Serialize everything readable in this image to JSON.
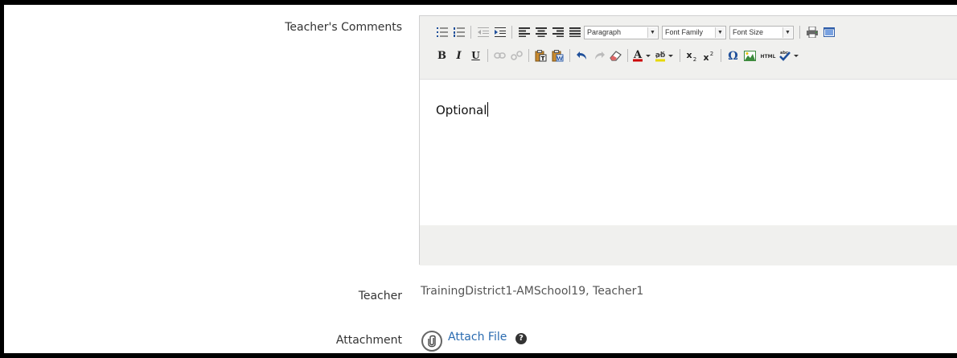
{
  "labels": {
    "comments": "Teacher's Comments",
    "teacher": "Teacher",
    "attachment": "Attachment"
  },
  "editor": {
    "toolbar": {
      "paragraph_select": "Paragraph",
      "font_family_select": "Font Family",
      "font_size_select": "Font Size",
      "html_button": "HTML"
    },
    "content": "Optional"
  },
  "teacher_value": "TrainingDistrict1-AMSchool19, Teacher1",
  "attachment": {
    "link_label": "Attach File",
    "help_glyph": "?"
  },
  "icons": {
    "bullet_list": "bullet-list-icon",
    "numbered_list": "numbered-list-icon",
    "outdent": "outdent-icon",
    "indent": "indent-icon",
    "align_left": "align-left-icon",
    "align_center": "align-center-icon",
    "align_right": "align-right-icon",
    "justify": "justify-icon",
    "print": "print-icon",
    "fullscreen": "fullscreen-icon",
    "link": "link-icon",
    "unlink": "unlink-icon",
    "paste_text": "paste-text-icon",
    "paste_word": "paste-word-icon",
    "undo": "undo-icon",
    "redo": "redo-icon",
    "remove_format": "eraser-icon",
    "font_color": "font-color-icon",
    "highlight": "highlight-icon",
    "subscript": "subscript-icon",
    "superscript": "superscript-icon",
    "special_char": "omega-icon",
    "image": "image-icon",
    "spellcheck": "spellcheck-icon",
    "paperclip": "paperclip-icon",
    "help": "help-icon"
  },
  "colors": {
    "link": "#2a6bb0",
    "toolbar_bg": "#f0f0ee",
    "font_color_bar": "#cc0000",
    "highlight_bar": "#e6d800"
  }
}
